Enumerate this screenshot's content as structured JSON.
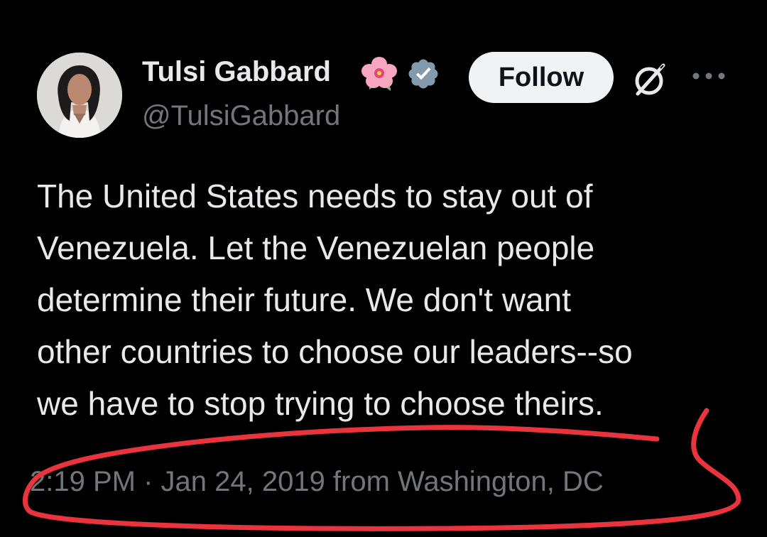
{
  "author": {
    "display_name": "Tulsi Gabbard",
    "handle": "@TulsiGabbard",
    "flower_icon": "hibiscus-emoji-icon",
    "verified_icon": "verified-badge-icon",
    "verified_color": "#829aab"
  },
  "actions": {
    "follow_label": "Follow",
    "grok_icon": "grok-icon",
    "more_icon": "more-options-icon"
  },
  "tweet": {
    "lines": [
      "The United States needs to stay out of",
      "Venezuela. Let the Venezuelan people",
      "determine their future. We don't want",
      "other countries to choose our leaders--so",
      "we have to stop trying to choose theirs."
    ],
    "timestamp": "2:19 PM · Jan 24, 2019 from Washington, DC"
  },
  "colors": {
    "background": "#000000",
    "text_primary": "#e7e9ea",
    "text_secondary": "#71767b",
    "annotation_red": "#e8343c"
  }
}
